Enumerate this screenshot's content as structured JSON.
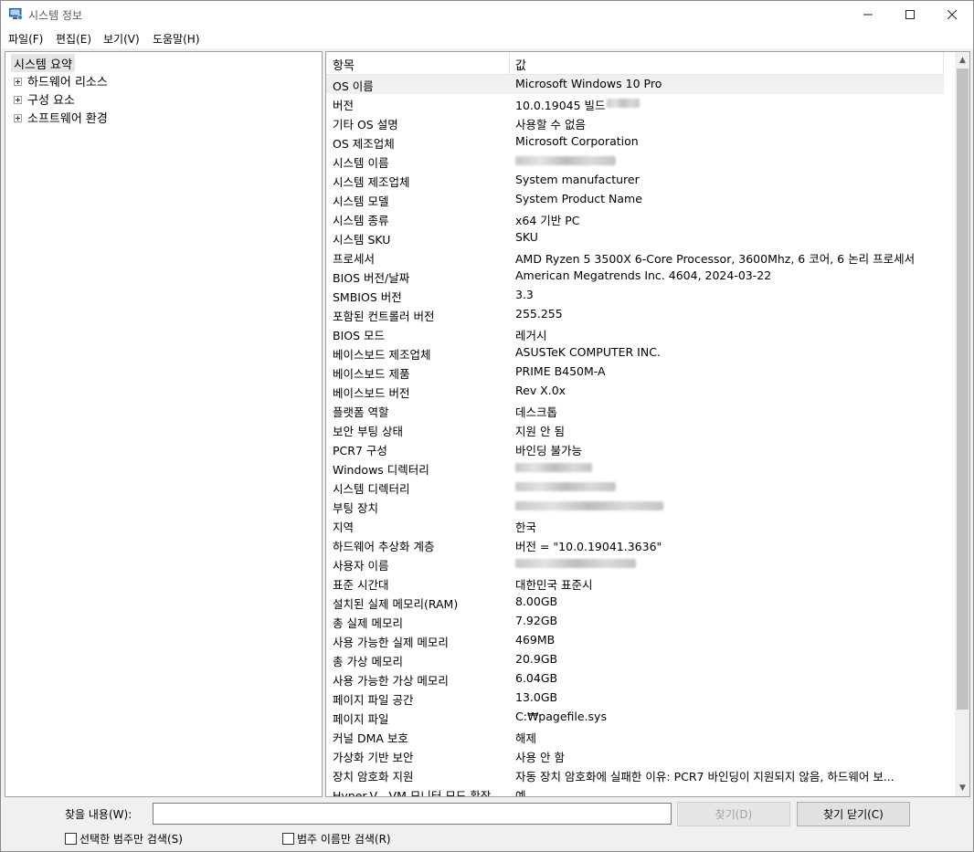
{
  "window": {
    "title": "시스템 정보"
  },
  "menu": [
    "파일(F)",
    "편집(E)",
    "보기(V)",
    "도움말(H)"
  ],
  "tree": {
    "root": "시스템 요약",
    "children": [
      "하드웨어 리소스",
      "구성 요소",
      "소프트웨어 환경"
    ]
  },
  "list": {
    "col_item": "항목",
    "col_value": "값",
    "rows": [
      {
        "k": "OS 이름",
        "v": "Microsoft Windows 10 Pro"
      },
      {
        "k": "버전",
        "v": "10.0.19045 빌드"
      },
      {
        "k": "기타 OS 설명",
        "v": "사용할 수 없음"
      },
      {
        "k": "OS 제조업체",
        "v": "Microsoft Corporation"
      },
      {
        "k": "시스템 이름",
        "v": ""
      },
      {
        "k": "시스템 제조업체",
        "v": "System manufacturer"
      },
      {
        "k": "시스템 모델",
        "v": "System Product Name"
      },
      {
        "k": "시스템 종류",
        "v": "x64 기반 PC"
      },
      {
        "k": "시스템 SKU",
        "v": "SKU"
      },
      {
        "k": "프로세서",
        "v": "AMD Ryzen 5 3500X 6-Core Processor, 3600Mhz, 6 코어, 6 논리 프로세서"
      },
      {
        "k": "BIOS 버전/날짜",
        "v": "American Megatrends Inc. 4604, 2024-03-22"
      },
      {
        "k": "SMBIOS 버전",
        "v": "3.3"
      },
      {
        "k": "포함된 컨트롤러 버전",
        "v": "255.255"
      },
      {
        "k": "BIOS 모드",
        "v": "레거시"
      },
      {
        "k": "베이스보드 제조업체",
        "v": "ASUSTeK COMPUTER INC."
      },
      {
        "k": "베이스보드 제품",
        "v": "PRIME B450M-A"
      },
      {
        "k": "베이스보드 버전",
        "v": "Rev X.0x"
      },
      {
        "k": "플랫폼 역할",
        "v": "데스크톱"
      },
      {
        "k": "보안 부팅 상태",
        "v": "지원 안 됨"
      },
      {
        "k": "PCR7 구성",
        "v": "바인딩 불가능"
      },
      {
        "k": "Windows 디렉터리",
        "v": ""
      },
      {
        "k": "시스템 디렉터리",
        "v": ""
      },
      {
        "k": "부팅 장치",
        "v": ""
      },
      {
        "k": "지역",
        "v": "한국"
      },
      {
        "k": "하드웨어 추상화 계층",
        "v": "버전 = \"10.0.19041.3636\""
      },
      {
        "k": "사용자 이름",
        "v": ""
      },
      {
        "k": "표준 시간대",
        "v": "대한민국 표준시"
      },
      {
        "k": "설치된 실제 메모리(RAM)",
        "v": "8.00GB"
      },
      {
        "k": "총 실제 메모리",
        "v": "7.92GB"
      },
      {
        "k": "사용 가능한 실제 메모리",
        "v": "469MB"
      },
      {
        "k": "총 가상 메모리",
        "v": "20.9GB"
      },
      {
        "k": "사용 가능한 가상 메모리",
        "v": "6.04GB"
      },
      {
        "k": "페이지 파일 공간",
        "v": "13.0GB"
      },
      {
        "k": "페이지 파일",
        "v": "C:₩pagefile.sys"
      },
      {
        "k": "커널 DMA 보호",
        "v": "해제"
      },
      {
        "k": "가상화 기반 보안",
        "v": "사용 안 함"
      },
      {
        "k": "장치 암호화 지원",
        "v": "자동 장치 암호화에 실패한 이유: PCR7 바인딩이 지원되지 않음, 하드웨어 보..."
      },
      {
        "k": "Hyper-V - VM 모니터 모드 확장",
        "v": "예"
      }
    ]
  },
  "find": {
    "label": "찾을 내용(W):",
    "value": "",
    "find_button": "찾기(D)",
    "close_button": "찾기 닫기(C)",
    "chk_selected": "선택한 범주만 검색(S)",
    "chk_names": "범주 이름만 검색(R)"
  }
}
